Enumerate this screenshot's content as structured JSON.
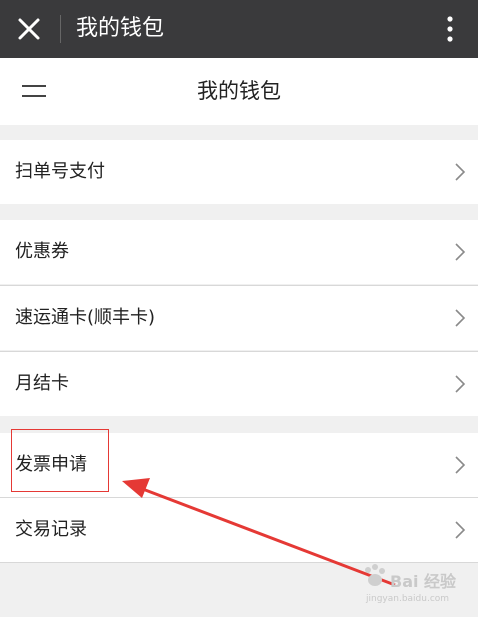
{
  "topbar": {
    "title": "我的钱包",
    "close_icon": "close-icon",
    "more_icon": "more-vertical-icon"
  },
  "navbar": {
    "title": "我的钱包",
    "menu_icon": "menu-icon"
  },
  "sections": [
    {
      "items": [
        {
          "label": "扫单号支付"
        }
      ]
    },
    {
      "items": [
        {
          "label": "优惠券"
        },
        {
          "label": "速运通卡(顺丰卡)"
        },
        {
          "label": "月结卡"
        }
      ]
    },
    {
      "items": [
        {
          "label": "发票申请"
        },
        {
          "label": "交易记录"
        }
      ]
    }
  ],
  "annotation": {
    "highlight_color": "#e53935"
  },
  "watermark": {
    "text": "Bai 经验",
    "url": "jingyan.baidu.com"
  },
  "colors": {
    "topbar_bg": "#3a3a3c",
    "page_bg": "#f0f0f0",
    "row_bg": "#ffffff"
  }
}
